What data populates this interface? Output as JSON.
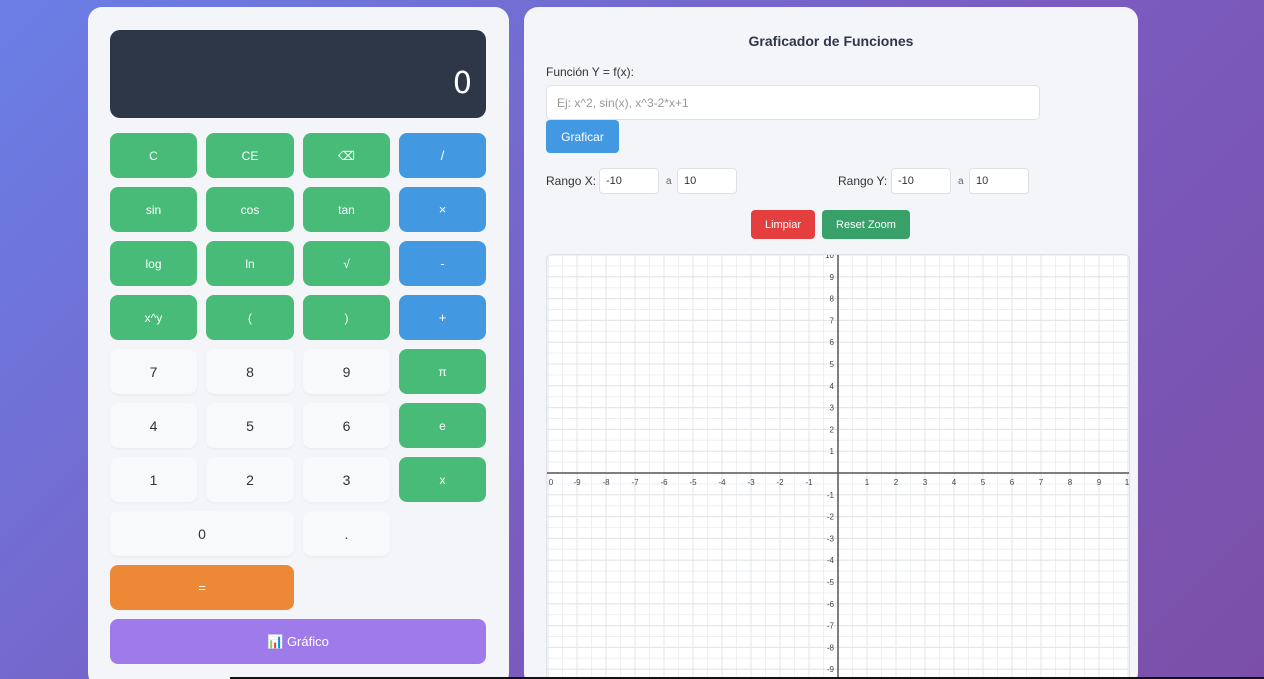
{
  "calculator": {
    "display_value": "0",
    "buttons": {
      "clear": "C",
      "clear_entry": "CE",
      "backspace": "⌫",
      "divide": "/",
      "sin": "sin",
      "cos": "cos",
      "tan": "tan",
      "multiply": "×",
      "log": "log",
      "ln": "ln",
      "sqrt": "√",
      "subtract": "-",
      "power": "x^y",
      "paren_open": "(",
      "paren_close": ")",
      "add": "+",
      "seven": "7",
      "eight": "8",
      "nine": "9",
      "pi": "π",
      "four": "4",
      "five": "5",
      "six": "6",
      "e": "e",
      "one": "1",
      "two": "2",
      "three": "3",
      "x": "x",
      "zero": "0",
      "dot": ".",
      "equals": "=",
      "graph": "📊 Gráfico"
    }
  },
  "grapher": {
    "title": "Graficador de Funciones",
    "function_label": "Función Y = f(x):",
    "function_value": "",
    "function_placeholder": "Ej: x^2, sin(x), x^3-2*x+1",
    "plot_button": "Graficar",
    "range_x_label": "Rango X:",
    "range_y_label": "Rango Y:",
    "range_sep": "a",
    "x_min": "-10",
    "x_max": "10",
    "y_min": "-10",
    "y_max": "10",
    "clear_button": "Limpiar",
    "reset_zoom_button": "Reset Zoom"
  },
  "colors": {
    "green": "#48bb78",
    "blue": "#4299e1",
    "orange": "#ed8936",
    "purple": "#9f7aea",
    "red": "#e53e3e",
    "dark_green": "#38a169",
    "display_bg": "#2d3748"
  },
  "graph": {
    "x_range": [
      -10,
      10
    ],
    "y_range": [
      -10,
      10
    ],
    "x_ticks": [
      "0",
      "-9",
      "-8",
      "-7",
      "-6",
      "-5",
      "-4",
      "-3",
      "-2",
      "-1",
      "1",
      "2",
      "3",
      "4",
      "5",
      "6",
      "7",
      "8",
      "9",
      "1"
    ],
    "y_ticks_pos": [
      "10",
      "9",
      "8",
      "7",
      "6",
      "5",
      "4",
      "3",
      "2",
      "1"
    ],
    "y_ticks_neg": [
      "-1",
      "-2",
      "-3",
      "-4",
      "-5",
      "-6",
      "-7",
      "-8",
      "-9"
    ]
  }
}
